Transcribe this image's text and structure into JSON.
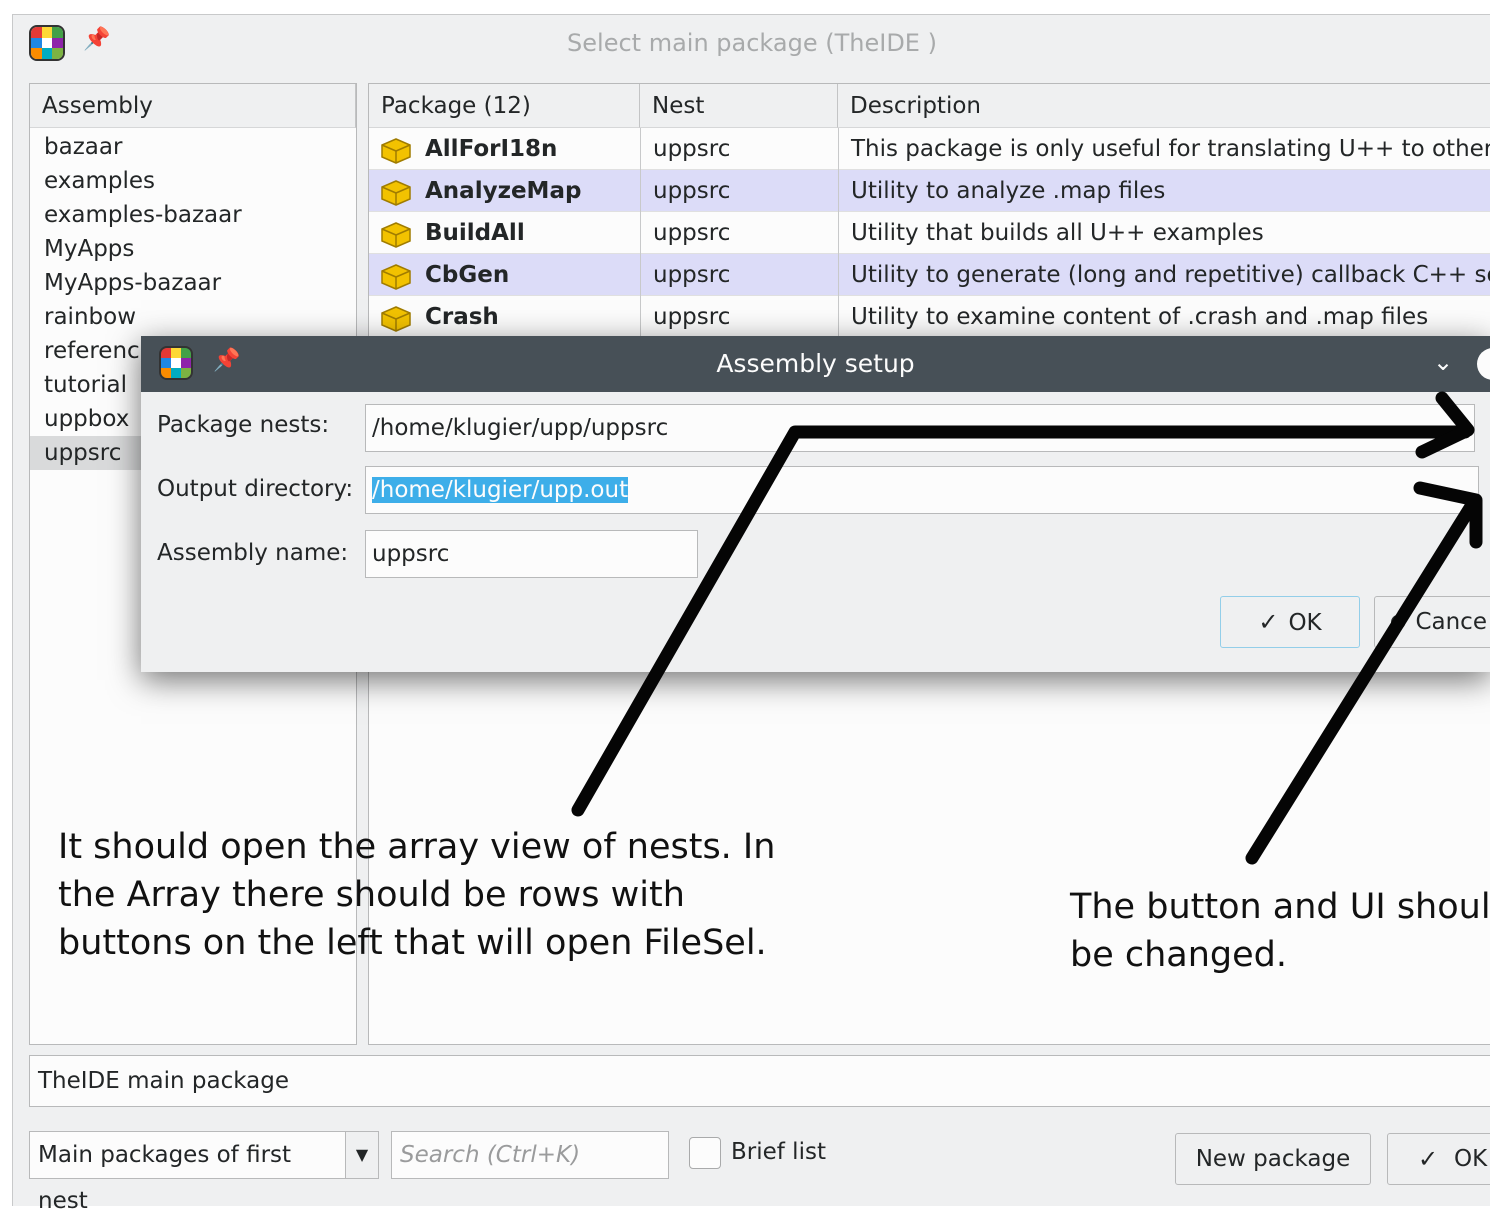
{
  "window": {
    "title": "Select main package (TheIDE )"
  },
  "assembly": {
    "header": "Assembly",
    "items": [
      "bazaar",
      "examples",
      "examples-bazaar",
      "MyApps",
      "MyApps-bazaar",
      "rainbow",
      "referenc",
      "tutorial",
      "uppbox",
      "uppsrc"
    ],
    "selected_index": 9
  },
  "packages": {
    "headers": [
      "Package (12)",
      "Nest",
      "Description"
    ],
    "rows": [
      {
        "name": "AllForI18n",
        "nest": "uppsrc",
        "description": "This package is only useful for translating U++ to other lar"
      },
      {
        "name": "AnalyzeMap",
        "nest": "uppsrc",
        "description": "Utility to analyze .map files"
      },
      {
        "name": "BuildAll",
        "nest": "uppsrc",
        "description": "Utility that builds all U++ examples"
      },
      {
        "name": "CbGen",
        "nest": "uppsrc",
        "description": "Utility to generate (long and repetitive) callback C++ sourc"
      },
      {
        "name": "Crash",
        "nest": "uppsrc",
        "description": "Utility to examine content of .crash and .map files"
      }
    ]
  },
  "description_field": "TheIDE main package",
  "bottom": {
    "filter_value": "Main packages of first nest",
    "search_placeholder": "Search (Ctrl+K)",
    "brief_label": "Brief list",
    "new_package_label": "New package",
    "ok_label": "OK"
  },
  "dialog": {
    "title": "Assembly setup",
    "package_nests_label": "Package nests:",
    "package_nests_value": "/home/klugier/upp/uppsrc",
    "output_dir_label": "Output directory:",
    "output_dir_value": "/home/klugier/upp.out",
    "assembly_name_label": "Assembly name:",
    "assembly_name_value": "uppsrc",
    "ok_label": "OK",
    "cancel_label": "Cance"
  },
  "annotations": {
    "note1": [
      "It should open the array view of nests. In",
      "the Array there should be rows with",
      "buttons on the left that will open FileSel."
    ],
    "note2": [
      "The button and UI shoul",
      "be changed."
    ]
  }
}
